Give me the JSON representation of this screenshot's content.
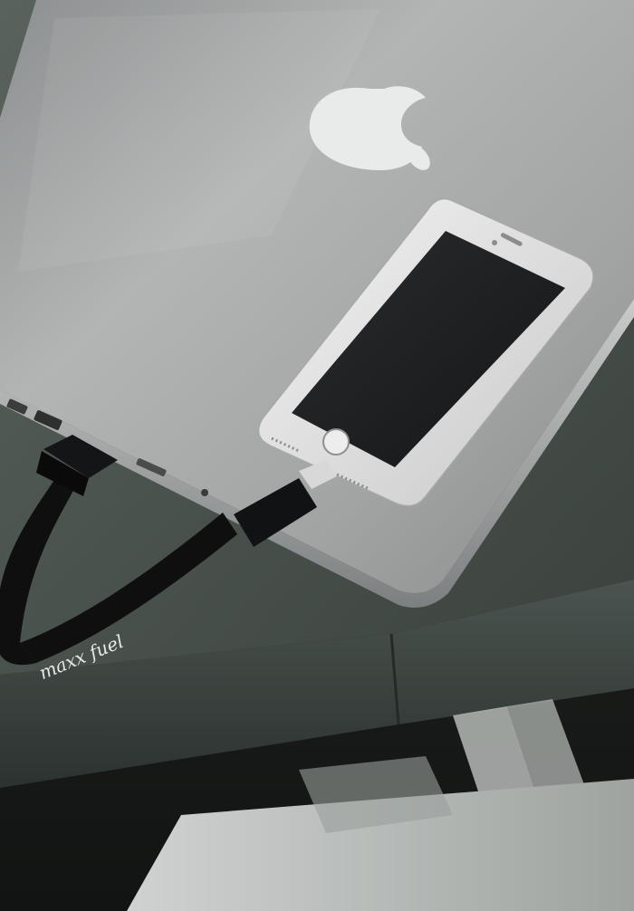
{
  "photo": {
    "cable_print": "maxx fuel",
    "objects": [
      "laptop",
      "apple-logo",
      "smartphone",
      "usb-cable",
      "table",
      "chair"
    ],
    "colors": {
      "laptop": "#a9abab",
      "phone_body": "#dcdcdc",
      "phone_screen": "#1b1d1f",
      "cable": "#0f0f10",
      "table": "#4a524d",
      "background": "#1c1f1d"
    }
  }
}
